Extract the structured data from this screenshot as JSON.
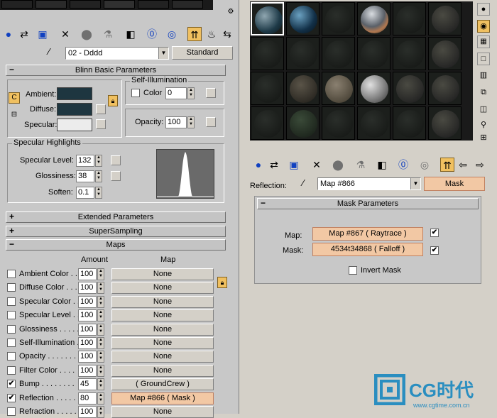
{
  "left": {
    "toolbar_icons": [
      "get-material-icon",
      "put-material-icon",
      "assign-material-icon",
      "delete-icon",
      "make-unique-icon",
      "put-library-icon",
      "material-id-icon",
      "show-map-icon",
      "show-end-result-icon",
      "go-parent-icon",
      "go-sibling-icon"
    ],
    "material_name": "02 - Dddd",
    "material_type": "Standard",
    "blinn": {
      "title": "Blinn Basic Parameters",
      "self_illum_title": "Self-Illumination",
      "ambient_label": "Ambient:",
      "diffuse_label": "Diffuse:",
      "specular_label": "Specular:",
      "color_label": "Color",
      "color_value": "0",
      "opacity_label": "Opacity:",
      "opacity_value": "100",
      "ambient_color": "#1e3640",
      "diffuse_color": "#1e3640",
      "specular_color": "#ececec"
    },
    "spec": {
      "title": "Specular Highlights",
      "level_label": "Specular Level:",
      "level_value": "132",
      "gloss_label": "Glossiness:",
      "gloss_value": "38",
      "soften_label": "Soften:",
      "soften_value": "0.1"
    },
    "extended_title": "Extended Parameters",
    "supersampling_title": "SuperSampling",
    "maps": {
      "title": "Maps",
      "amount_header": "Amount",
      "map_header": "Map",
      "rows": [
        {
          "label": "Ambient Color . .",
          "amount": "100",
          "map": "None",
          "checked": ""
        },
        {
          "label": "Diffuse Color . . .",
          "amount": "100",
          "map": "None",
          "checked": ""
        },
        {
          "label": "Specular Color . .",
          "amount": "100",
          "map": "None",
          "checked": ""
        },
        {
          "label": "Specular Level . .",
          "amount": "100",
          "map": "None",
          "checked": ""
        },
        {
          "label": "Glossiness . . . . .",
          "amount": "100",
          "map": "None",
          "checked": ""
        },
        {
          "label": "Self-Illumination . .",
          "amount": "100",
          "map": "None",
          "checked": ""
        },
        {
          "label": "Opacity . . . . . . .",
          "amount": "100",
          "map": "None",
          "checked": ""
        },
        {
          "label": "Filter Color . . . .",
          "amount": "100",
          "map": "None",
          "checked": ""
        },
        {
          "label": "Bump . . . . . . . .",
          "amount": "45",
          "map": "( GroundCrew )",
          "checked": "✔"
        },
        {
          "label": "Reflection . . . . .",
          "amount": "80",
          "map": "Map #866  ( Mask )",
          "checked": "✔"
        },
        {
          "label": "Refraction . . . . .",
          "amount": "100",
          "map": "None",
          "checked": ""
        }
      ]
    }
  },
  "right": {
    "toolbar_icons": [
      "get-material-icon",
      "put-material-icon",
      "assign-material-icon",
      "delete-icon",
      "make-unique-icon",
      "put-library-icon",
      "material-id-icon",
      "show-map-icon",
      "show-end-result-icon",
      "go-parent-icon",
      "go-sibling-icon"
    ],
    "reflection_label": "Reflection:",
    "map_name": "Map #866",
    "map_type": "Mask",
    "mask": {
      "title": "Mask Parameters",
      "map_label": "Map:",
      "map_value": "Map #867  ( Raytrace )",
      "mask_label": "Mask:",
      "mask_value": "4534t34868  ( Falloff )",
      "invert_label": "Invert Mask"
    }
  },
  "watermark": {
    "brand": "CG时代",
    "url": "www.cgtime.com.cn"
  },
  "colors": {
    "orange_button": "#f2c8a4",
    "panel": "#c8c8c8",
    "slot_bg": "#1c1f1c"
  }
}
